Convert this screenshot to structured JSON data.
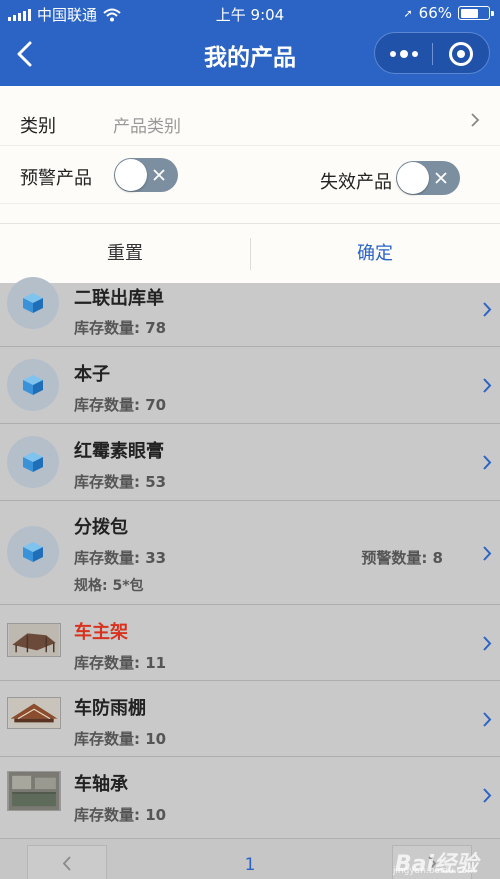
{
  "status_bar": {
    "carrier": "中国联通",
    "time": "上午 9:04",
    "battery": "66%",
    "battery_level": 0.66
  },
  "header": {
    "title": "我的产品"
  },
  "filter": {
    "category_label": "类别",
    "category_placeholder": "产品类别",
    "warning_label": "预警产品",
    "expired_label": "失效产品",
    "reset_label": "重置",
    "confirm_label": "确定"
  },
  "items": [
    {
      "name": "二联出库单",
      "stock": "库存数量: 78"
    },
    {
      "name": "本子",
      "stock": "库存数量: 70"
    },
    {
      "name": "红霉素眼膏",
      "stock": "库存数量: 53"
    },
    {
      "name": "分拨包",
      "stock": "库存数量: 33",
      "alert": "预警数量: 8",
      "spec": "规格: 5*包"
    },
    {
      "name": "车主架",
      "stock": "库存数量: 11"
    },
    {
      "name": "车防雨棚",
      "stock": "库存数量: 10"
    },
    {
      "name": "车轴承",
      "stock": "库存数量: 10"
    }
  ],
  "pager": {
    "page": "1"
  },
  "watermark": {
    "logo": "Bai经验",
    "site": "jingyan.baidu.com"
  },
  "colors": {
    "brand": "#2b64c4",
    "warning_name": "#d8321f"
  }
}
